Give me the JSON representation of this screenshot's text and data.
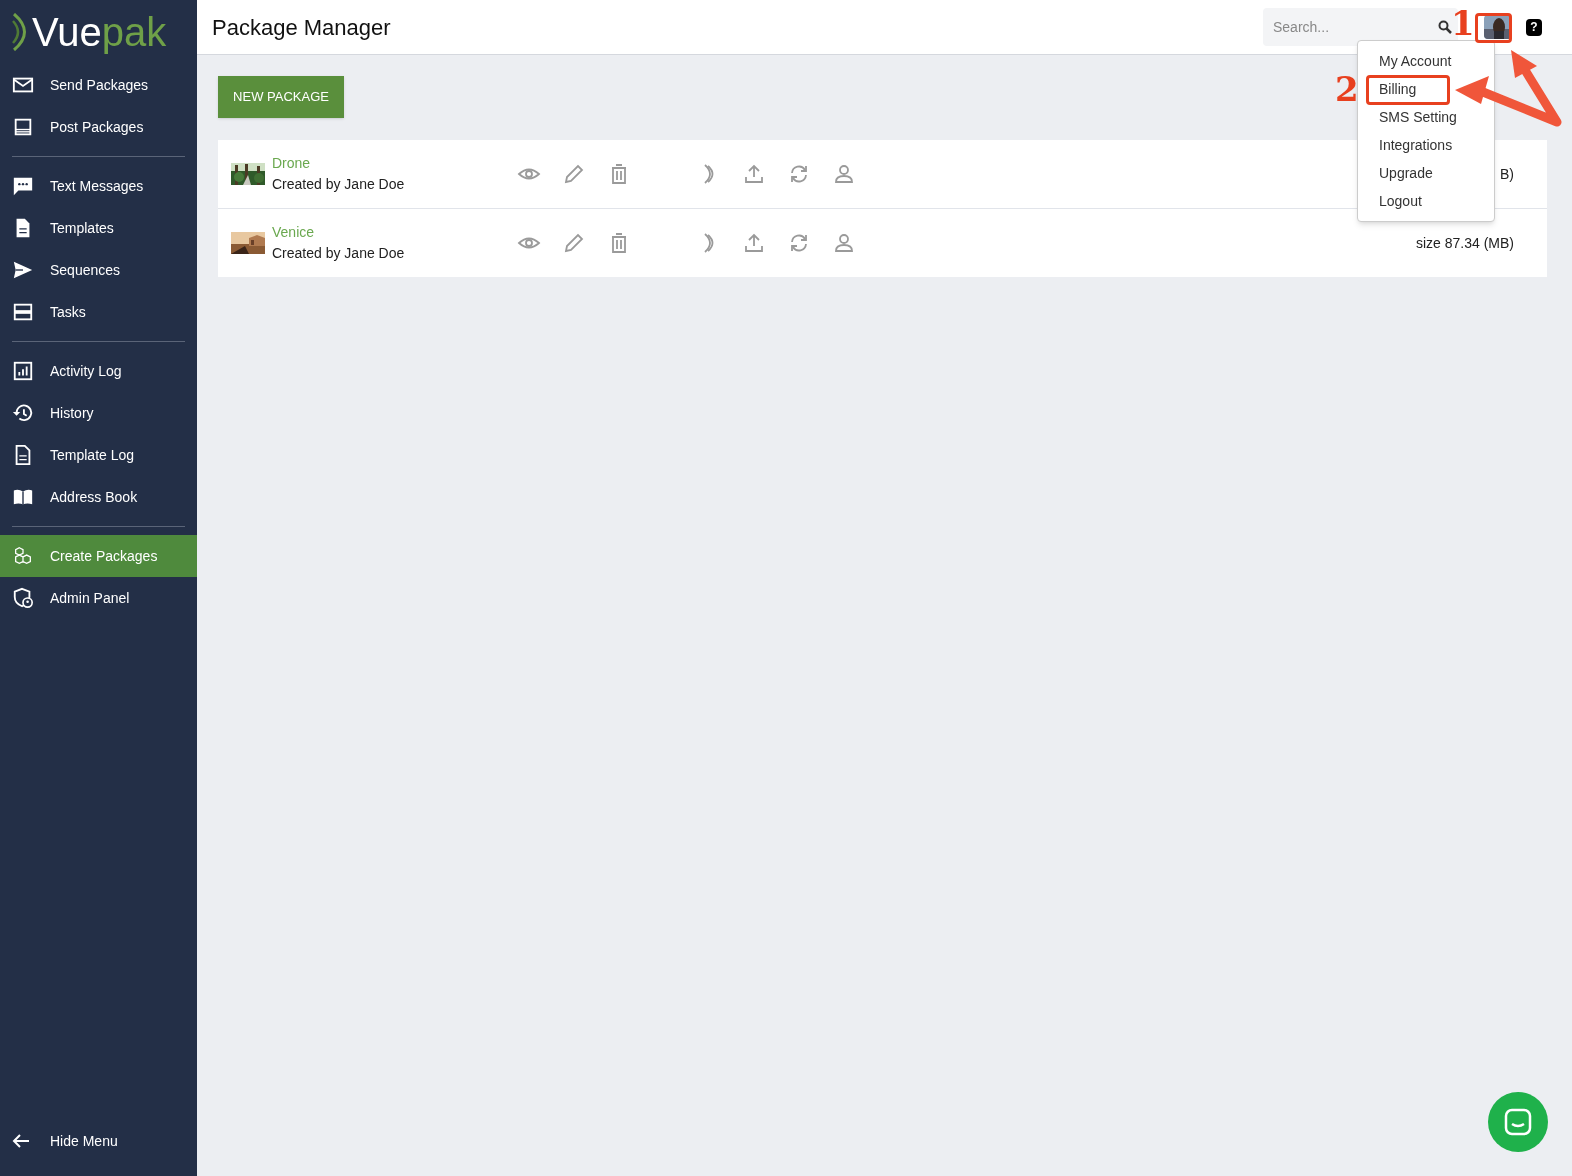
{
  "sidebar": {
    "logo": {
      "part_1": "Vue",
      "part_2": "pak"
    },
    "groups": [
      {
        "items": [
          {
            "label": "Send Packages",
            "selected": false
          },
          {
            "label": "Post Packages",
            "selected": false
          }
        ]
      },
      {
        "items": [
          {
            "label": "Text Messages",
            "selected": false
          },
          {
            "label": "Templates",
            "selected": false
          },
          {
            "label": "Sequences",
            "selected": false
          },
          {
            "label": "Tasks",
            "selected": false
          }
        ]
      },
      {
        "items": [
          {
            "label": "Activity Log",
            "selected": false
          },
          {
            "label": "History",
            "selected": false
          },
          {
            "label": "Template Log",
            "selected": false
          },
          {
            "label": "Address Book",
            "selected": false
          }
        ]
      },
      {
        "items": [
          {
            "label": "Create Packages",
            "selected": true
          },
          {
            "label": "Admin Panel",
            "selected": false
          }
        ]
      }
    ],
    "hide_menu": "Hide Menu"
  },
  "header": {
    "title": "Package Manager",
    "search": {
      "placeholder": "Search..."
    },
    "help": "?"
  },
  "new_package_button": "NEW PACKAGE",
  "packages": [
    {
      "name": "Drone",
      "creator": "Created by Jane Doe",
      "size": "B)"
    },
    {
      "name": "Venice",
      "creator": "Created by Jane Doe",
      "size": "size 87.34 (MB)"
    }
  ],
  "account_menu": {
    "items": [
      "My Account",
      "Billing",
      "SMS Setting",
      "Integrations",
      "Upgrade",
      "Logout"
    ]
  },
  "annotations": [
    {
      "label": "1"
    },
    {
      "label": "2"
    }
  ]
}
